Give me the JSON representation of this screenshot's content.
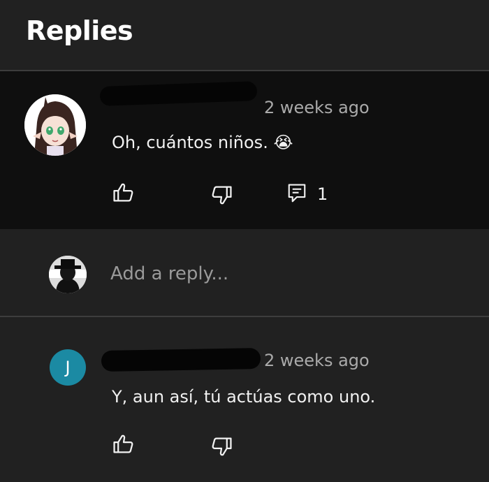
{
  "header": {
    "title": "Replies"
  },
  "main_comment": {
    "author_redacted": true,
    "timestamp": "2 weeks ago",
    "text": "Oh, cuántos niños. 😭",
    "reply_count": "1",
    "icons": {
      "like": "thumbs-up-icon",
      "dislike": "thumbs-down-icon",
      "replies": "comment-icon"
    }
  },
  "add_reply": {
    "placeholder": "Add a reply..."
  },
  "reply": {
    "avatar_initial": "J",
    "author_redacted": true,
    "timestamp": "2 weeks ago",
    "text": "Y, aun así, tú actúas como uno.",
    "icons": {
      "like": "thumbs-up-icon",
      "dislike": "thumbs-down-icon"
    }
  },
  "colors": {
    "background": "#212121",
    "comment_bg": "#0f0f0f",
    "avatar_j": "#1b8aa3",
    "secondary_text": "#aaaaaa"
  }
}
